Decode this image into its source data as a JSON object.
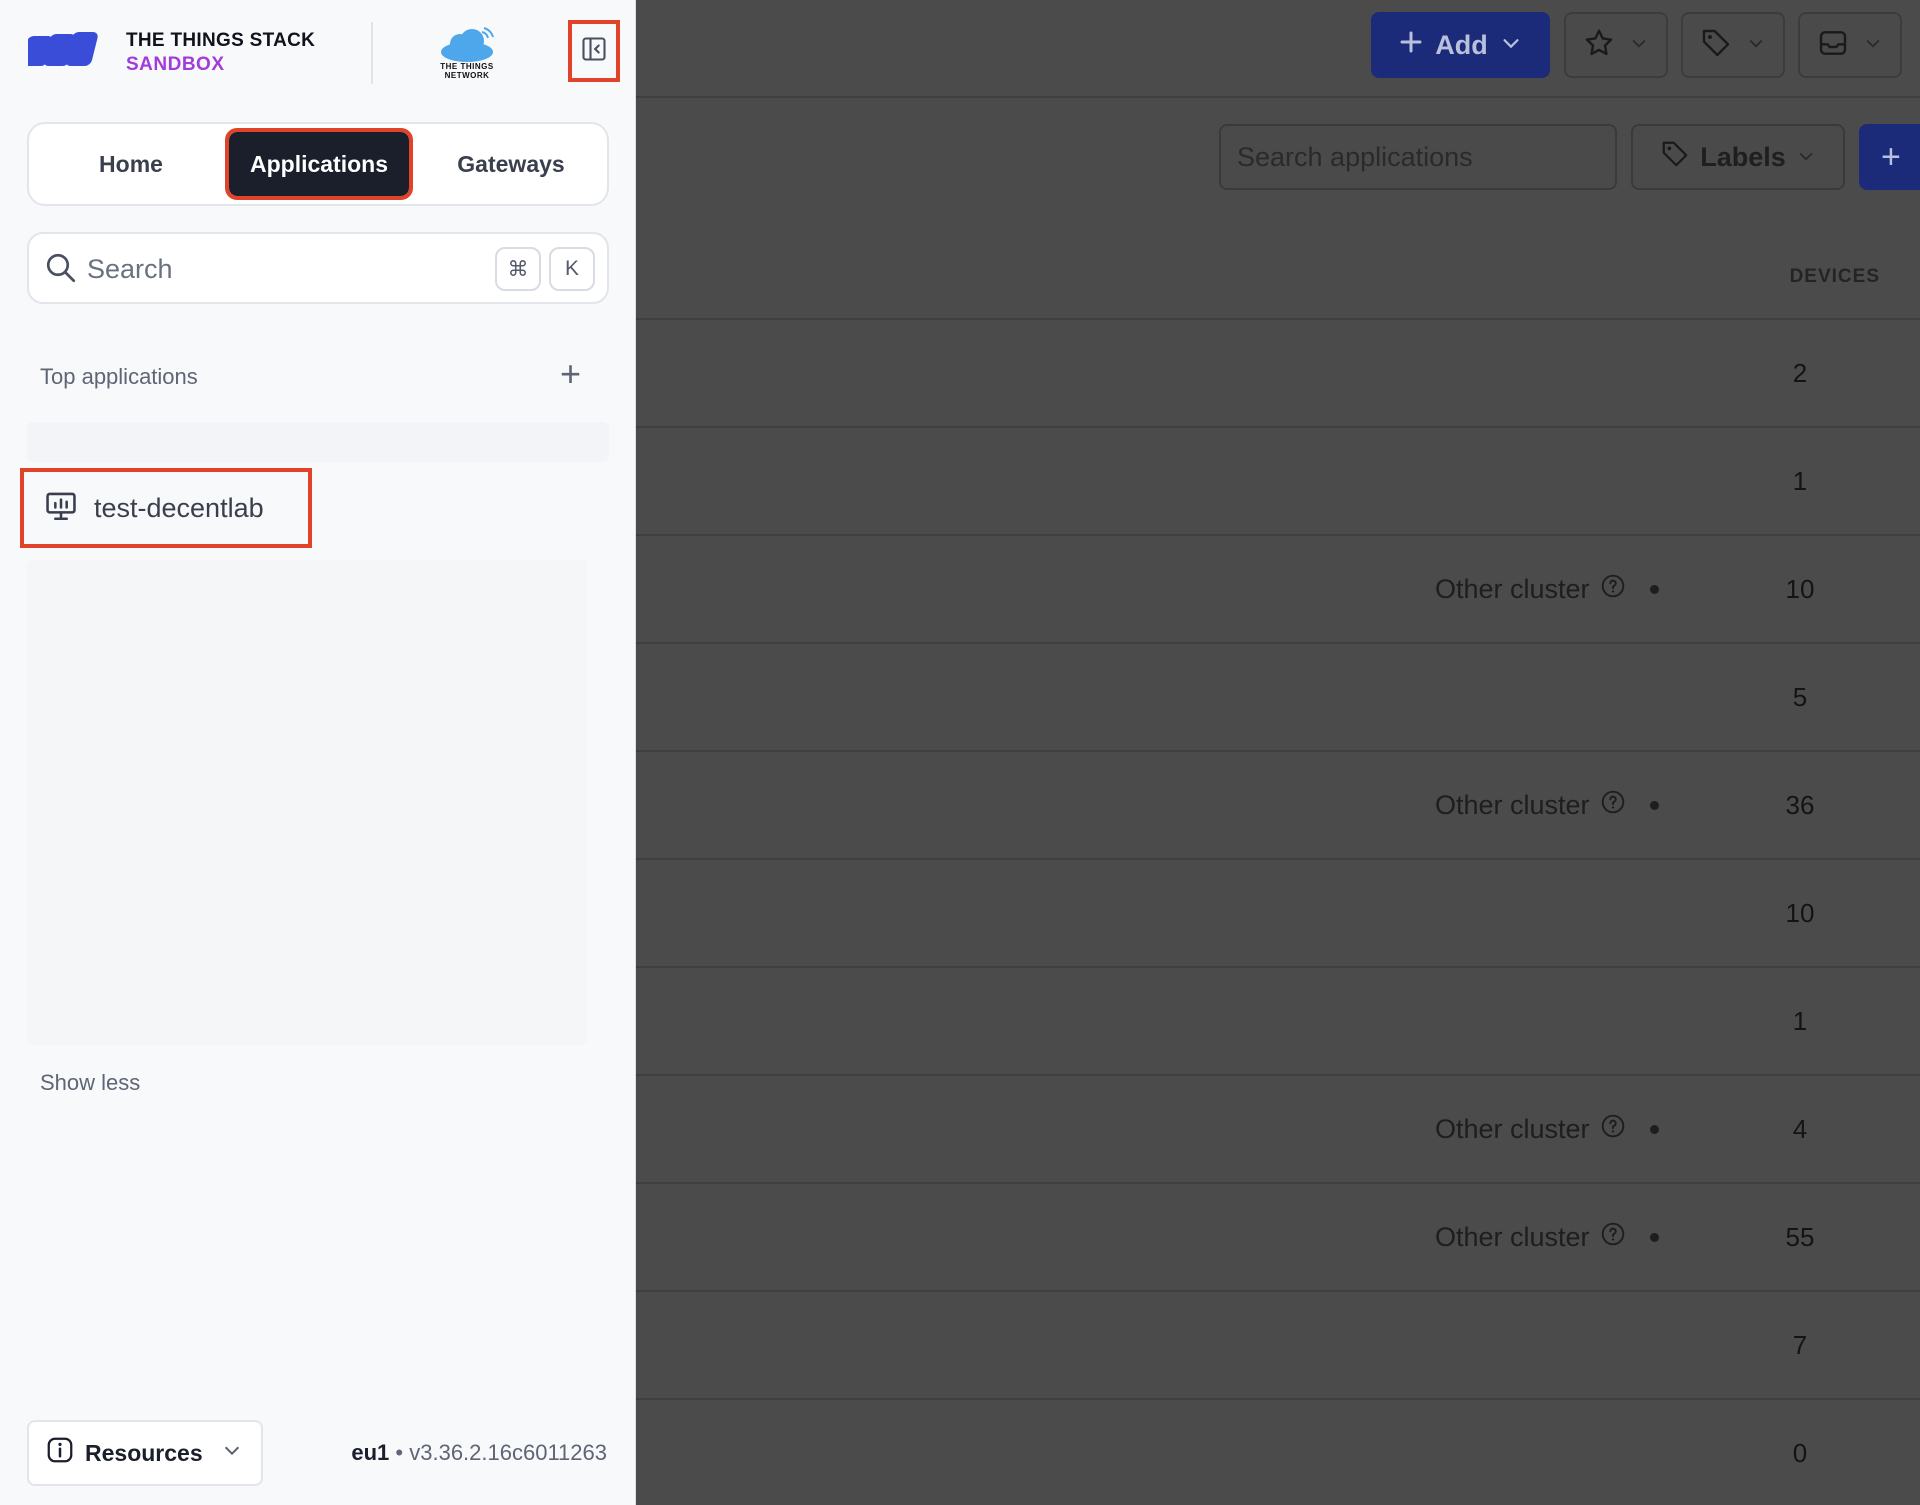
{
  "brand": {
    "line1": "THE THINGS STACK",
    "line2": "SANDBOX",
    "partner_line1": "THE THINGS",
    "partner_line2": "NETWORK",
    "accent": "#a23bd8",
    "logo_color": "#3a4dd8"
  },
  "header": {
    "add_label": "Add",
    "icons": [
      "star-icon",
      "tag-icon",
      "inbox-icon"
    ]
  },
  "toolbar": {
    "search_placeholder": "Search applications",
    "labels_label": "Labels",
    "create_label": "+"
  },
  "table": {
    "devices_header": "DEVICES",
    "cluster_text": "Other cluster",
    "rows": [
      {
        "devices": "2",
        "other_cluster": false
      },
      {
        "devices": "1",
        "other_cluster": false
      },
      {
        "devices": "10",
        "other_cluster": true
      },
      {
        "devices": "5",
        "other_cluster": false
      },
      {
        "devices": "36",
        "other_cluster": true
      },
      {
        "devices": "10",
        "other_cluster": false
      },
      {
        "devices": "1",
        "other_cluster": false
      },
      {
        "devices": "4",
        "other_cluster": true
      },
      {
        "devices": "55",
        "other_cluster": true
      },
      {
        "devices": "7",
        "other_cluster": false
      },
      {
        "devices": "0",
        "other_cluster": false
      }
    ]
  },
  "sidebar": {
    "tabs": [
      {
        "label": "Home",
        "active": false
      },
      {
        "label": "Applications",
        "active": true
      },
      {
        "label": "Gateways",
        "active": false
      }
    ],
    "search": {
      "placeholder": "Search",
      "kbd_cmd": "⌘",
      "kbd_k": "K"
    },
    "top_apps_title": "Top applications",
    "top_apps_add": "+",
    "apps": [
      {
        "name": "test-decentlab"
      }
    ],
    "show_less": "Show less",
    "resources_label": "Resources",
    "cluster": "eu1",
    "version": "v3.36.2.16c6011263"
  },
  "colors": {
    "highlight": "#e0432a",
    "active_tab_bg": "#1b1f2c",
    "primary": "#1c2a7a"
  }
}
